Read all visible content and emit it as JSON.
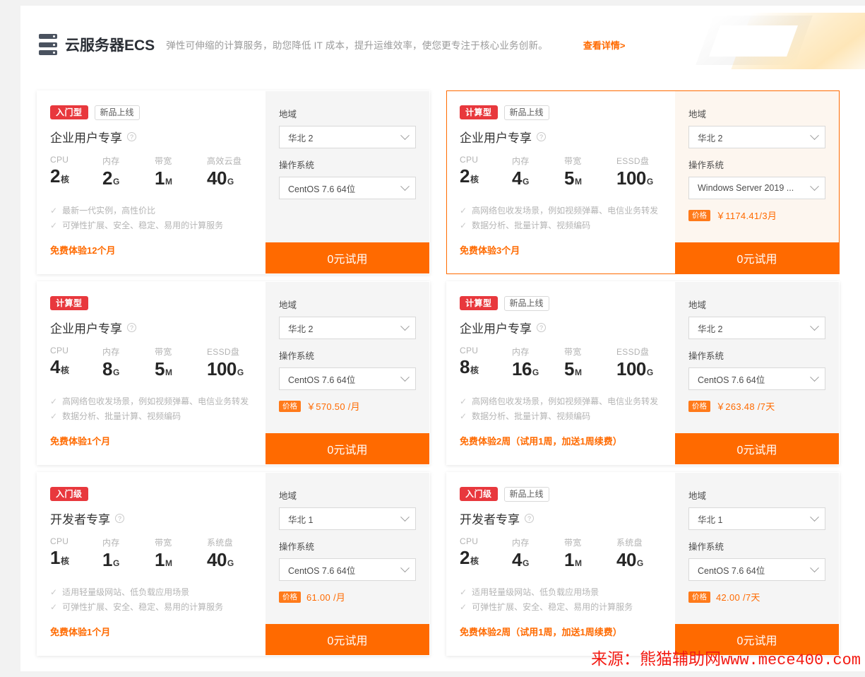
{
  "header": {
    "logo_icon": "server-stack-icon",
    "title": "云服务器ECS",
    "subtitle": "弹性可伸缩的计算服务，助您降低 IT 成本，提升运维效率，使您更专注于核心业务创新。",
    "link": "查看详情>"
  },
  "labels": {
    "region": "地域",
    "os": "操作系统",
    "price_badge": "价格",
    "cta": "0元试用",
    "help_icon": "?",
    "check_icon": "✓",
    "chevron_icon": "chevron-down"
  },
  "watermark": {
    "prefix": "来源：",
    "site_cn": "熊猫辅助网",
    "site_url": "www.mece400.com"
  },
  "cards": [
    {
      "selected": false,
      "tag": "入门型",
      "tag_new": "新品上线",
      "title": "企业用户专享",
      "specs": [
        {
          "label": "CPU",
          "value": "2",
          "unit": "核"
        },
        {
          "label": "内存",
          "value": "2",
          "unit": "G"
        },
        {
          "label": "带宽",
          "value": "1",
          "unit": "M"
        },
        {
          "label": "高效云盘",
          "value": "40",
          "unit": "G"
        }
      ],
      "features": [
        "最新一代实例，高性价比",
        "可弹性扩展、安全、稳定、易用的计算服务"
      ],
      "free_text": "免费体验12个月",
      "region_value": "华北 2",
      "os_value": "CentOS 7.6 64位",
      "price": "",
      "cta": "0元试用"
    },
    {
      "selected": true,
      "tag": "计算型",
      "tag_new": "新品上线",
      "title": "企业用户专享",
      "specs": [
        {
          "label": "CPU",
          "value": "2",
          "unit": "核"
        },
        {
          "label": "内存",
          "value": "4",
          "unit": "G"
        },
        {
          "label": "带宽",
          "value": "5",
          "unit": "M"
        },
        {
          "label": "ESSD盘",
          "value": "100",
          "unit": "G"
        }
      ],
      "features": [
        "高网络包收发场景，例如视频弹幕、电信业务转发",
        "数据分析、批量计算、视频编码"
      ],
      "free_text": "免费体验3个月",
      "region_value": "华北 2",
      "os_value": "Windows Server 2019 ...",
      "price": "￥1174.41/3月",
      "cta": "0元试用"
    },
    {
      "selected": false,
      "tag": "计算型",
      "tag_new": "",
      "title": "企业用户专享",
      "specs": [
        {
          "label": "CPU",
          "value": "4",
          "unit": "核"
        },
        {
          "label": "内存",
          "value": "8",
          "unit": "G"
        },
        {
          "label": "带宽",
          "value": "5",
          "unit": "M"
        },
        {
          "label": "ESSD盘",
          "value": "100",
          "unit": "G"
        }
      ],
      "features": [
        "高网络包收发场景，例如视频弹幕、电信业务转发",
        "数据分析、批量计算、视频编码"
      ],
      "free_text": "免费体验1个月",
      "region_value": "华北 2",
      "os_value": "CentOS 7.6 64位",
      "price": "￥570.50 /月",
      "cta": "0元试用"
    },
    {
      "selected": false,
      "tag": "计算型",
      "tag_new": "新品上线",
      "title": "企业用户专享",
      "specs": [
        {
          "label": "CPU",
          "value": "8",
          "unit": "核"
        },
        {
          "label": "内存",
          "value": "16",
          "unit": "G"
        },
        {
          "label": "带宽",
          "value": "5",
          "unit": "M"
        },
        {
          "label": "ESSD盘",
          "value": "100",
          "unit": "G"
        }
      ],
      "features": [
        "高网络包收发场景，例如视频弹幕、电信业务转发",
        "数据分析、批量计算、视频编码"
      ],
      "free_text": "免费体验2周（试用1周，加送1周续费）",
      "region_value": "华北 2",
      "os_value": "CentOS 7.6 64位",
      "price": "￥263.48 /7天",
      "cta": "0元试用"
    },
    {
      "selected": false,
      "tag": "入门级",
      "tag_new": "",
      "title": "开发者专享",
      "specs": [
        {
          "label": "CPU",
          "value": "1",
          "unit": "核"
        },
        {
          "label": "内存",
          "value": "1",
          "unit": "G"
        },
        {
          "label": "带宽",
          "value": "1",
          "unit": "M"
        },
        {
          "label": "系统盘",
          "value": "40",
          "unit": "G"
        }
      ],
      "features": [
        "适用轻量级网站、低负载应用场景",
        "可弹性扩展、安全、稳定、易用的计算服务"
      ],
      "free_text": "免费体验1个月",
      "region_value": "华北 1",
      "os_value": "CentOS 7.6 64位",
      "price": "61.00 /月",
      "cta": "0元试用"
    },
    {
      "selected": false,
      "tag": "入门级",
      "tag_new": "新品上线",
      "title": "开发者专享",
      "specs": [
        {
          "label": "CPU",
          "value": "2",
          "unit": "核"
        },
        {
          "label": "内存",
          "value": "4",
          "unit": "G"
        },
        {
          "label": "带宽",
          "value": "1",
          "unit": "M"
        },
        {
          "label": "系统盘",
          "value": "40",
          "unit": "G"
        }
      ],
      "features": [
        "适用轻量级网站、低负载应用场景",
        "可弹性扩展、安全、稳定、易用的计算服务"
      ],
      "free_text": "免费体验2周（试用1周，加送1周续费）",
      "region_value": "华北 1",
      "os_value": "CentOS 7.6 64位",
      "price": "42.00 /7天",
      "cta": "0元试用"
    }
  ],
  "colors": {
    "accent": "#ff6a00",
    "tag_red": "#e8383d",
    "panel_bg": "#f5f5f5",
    "panel_bg_selected": "#fdf6ef",
    "watermark_red": "#f31b13"
  }
}
